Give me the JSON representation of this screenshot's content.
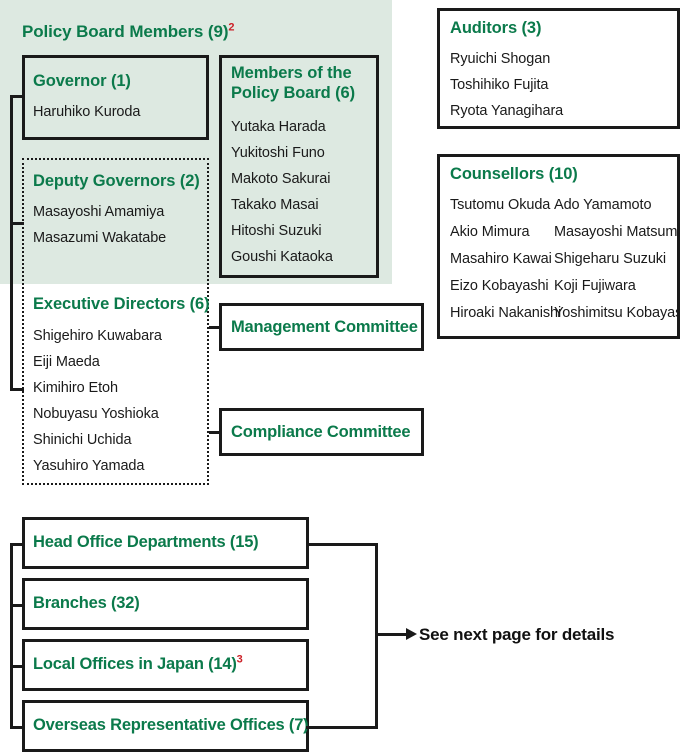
{
  "policy_board": {
    "title": "Policy Board Members (9)",
    "footnote": "2",
    "governor": {
      "title": "Governor (1)",
      "members": [
        "Haruhiko Kuroda"
      ]
    },
    "members_of_policy_board": {
      "title": "Members of the Policy Board (6)",
      "title_line1": "Members of the",
      "title_line2": "Policy Board (6)",
      "members": [
        "Yutaka Harada",
        "Yukitoshi Funo",
        "Makoto Sakurai",
        "Takako Masai",
        "Hitoshi Suzuki",
        "Goushi Kataoka"
      ]
    },
    "deputy_governors": {
      "title": "Deputy Governors (2)",
      "members": [
        "Masayoshi Amamiya",
        "Masazumi Wakatabe"
      ]
    }
  },
  "executive_directors": {
    "title": "Executive Directors (6)",
    "members": [
      "Shigehiro Kuwabara",
      "Eiji Maeda",
      "Kimihiro Etoh",
      "Nobuyasu Yoshioka",
      "Shinichi Uchida",
      "Yasuhiro Yamada"
    ]
  },
  "committees": [
    {
      "label": "Management Committee"
    },
    {
      "label": "Compliance Committee"
    }
  ],
  "auditors": {
    "title": "Auditors (3)",
    "members": [
      "Ryuichi Shogan",
      "Toshihiko Fujita",
      "Ryota Yanagihara"
    ]
  },
  "counsellors": {
    "title": "Counsellors (10)",
    "column1": [
      "Tsutomu Okuda",
      "Akio Mimura",
      "Masahiro Kawai",
      "Eizo Kobayashi",
      "Hiroaki Nakanishi"
    ],
    "column2": [
      "Ado Yamamoto",
      "Masayoshi Matsumoto",
      "Shigeharu Suzuki",
      "Koji Fujiwara",
      "Yoshimitsu Kobayashi"
    ]
  },
  "organization_units": [
    {
      "label": "Head Office Departments (15)",
      "footnote": ""
    },
    {
      "label": "Branches (32)",
      "footnote": ""
    },
    {
      "label": "Local Offices in Japan (14)",
      "footnote": "3"
    },
    {
      "label": "Overseas Representative Offices (7)",
      "footnote": ""
    }
  ],
  "note": {
    "text": "See next page for details"
  },
  "colors": {
    "accent_green": "#0b7a4b",
    "panel_green": "#dde9e1",
    "footnote_red": "#cc2027",
    "line_black": "#1a1a1a"
  }
}
